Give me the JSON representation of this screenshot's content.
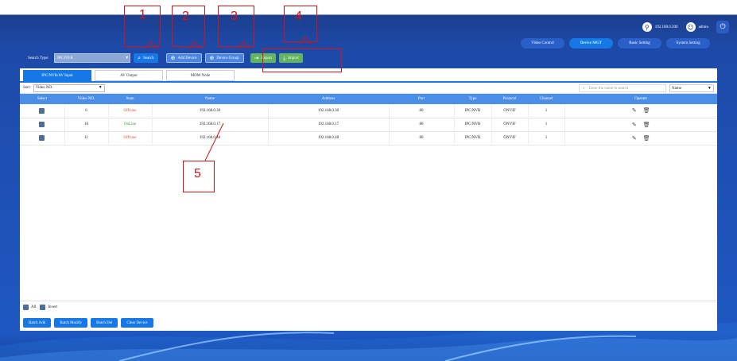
{
  "header": {
    "ip": "192.168.0.200",
    "user": "admin",
    "tabs": [
      {
        "label": "Video Control",
        "active": false
      },
      {
        "label": "Device MGT",
        "active": true
      },
      {
        "label": "Basic Setting",
        "active": false
      },
      {
        "label": "System Setting",
        "active": false
      }
    ]
  },
  "toolbar": {
    "search_type_label": "Search Type:",
    "search_type_value": "IPC/NVR",
    "search_label": "Search",
    "add_device_label": "Add Device",
    "device_group_label": "Device Group",
    "export_label": "Export",
    "import_label": "Import"
  },
  "sub_tabs": [
    {
      "label": "IPC/NVR/AV Input",
      "active": true
    },
    {
      "label": "AV Output",
      "active": false
    },
    {
      "label": "MDM Node",
      "active": false
    }
  ],
  "filter": {
    "sort_label": "Sort:",
    "sort_value": "Video NO.",
    "search_placeholder": "Enter the name to search",
    "search_field_value": "Name"
  },
  "table": {
    "columns": [
      "Select",
      "Video NO.",
      "State",
      "Name",
      "Address",
      "Port",
      "Type",
      "Protocol",
      "Channel",
      "Operate"
    ],
    "rows": [
      {
        "video_no": "6",
        "state": "OffLine",
        "state_kind": "off",
        "name": "192.168.0.30",
        "address": "192.168.0.30",
        "port": "80",
        "type": "IPC/NVR",
        "protocol": "ONVIF",
        "channel": "1"
      },
      {
        "video_no": "10",
        "state": "OnLine",
        "state_kind": "on",
        "name": "192.168.0.17",
        "address": "192.168.0.17",
        "port": "80",
        "type": "IPC/NVR",
        "protocol": "ONVIF",
        "channel": "1"
      },
      {
        "video_no": "11",
        "state": "OffLine",
        "state_kind": "off",
        "name": "192.168.0.48",
        "address": "192.168.0.48",
        "port": "80",
        "type": "IPC/NVR",
        "protocol": "ONVIF",
        "channel": "1"
      }
    ]
  },
  "selection": {
    "all_label": "All",
    "invert_label": "Invert"
  },
  "batch": {
    "add_label": "Batch Add",
    "modify_label": "Batch Modify",
    "del_label": "Batch Del",
    "clear_label": "Clear Device"
  },
  "annotations": [
    "1",
    "2",
    "3",
    "4",
    "5"
  ],
  "colors": {
    "accent": "#1677e6",
    "header_row": "#4a8ee8",
    "offline": "#e54d3f",
    "online": "#2e9d3c",
    "annotation": "#dd1111"
  }
}
